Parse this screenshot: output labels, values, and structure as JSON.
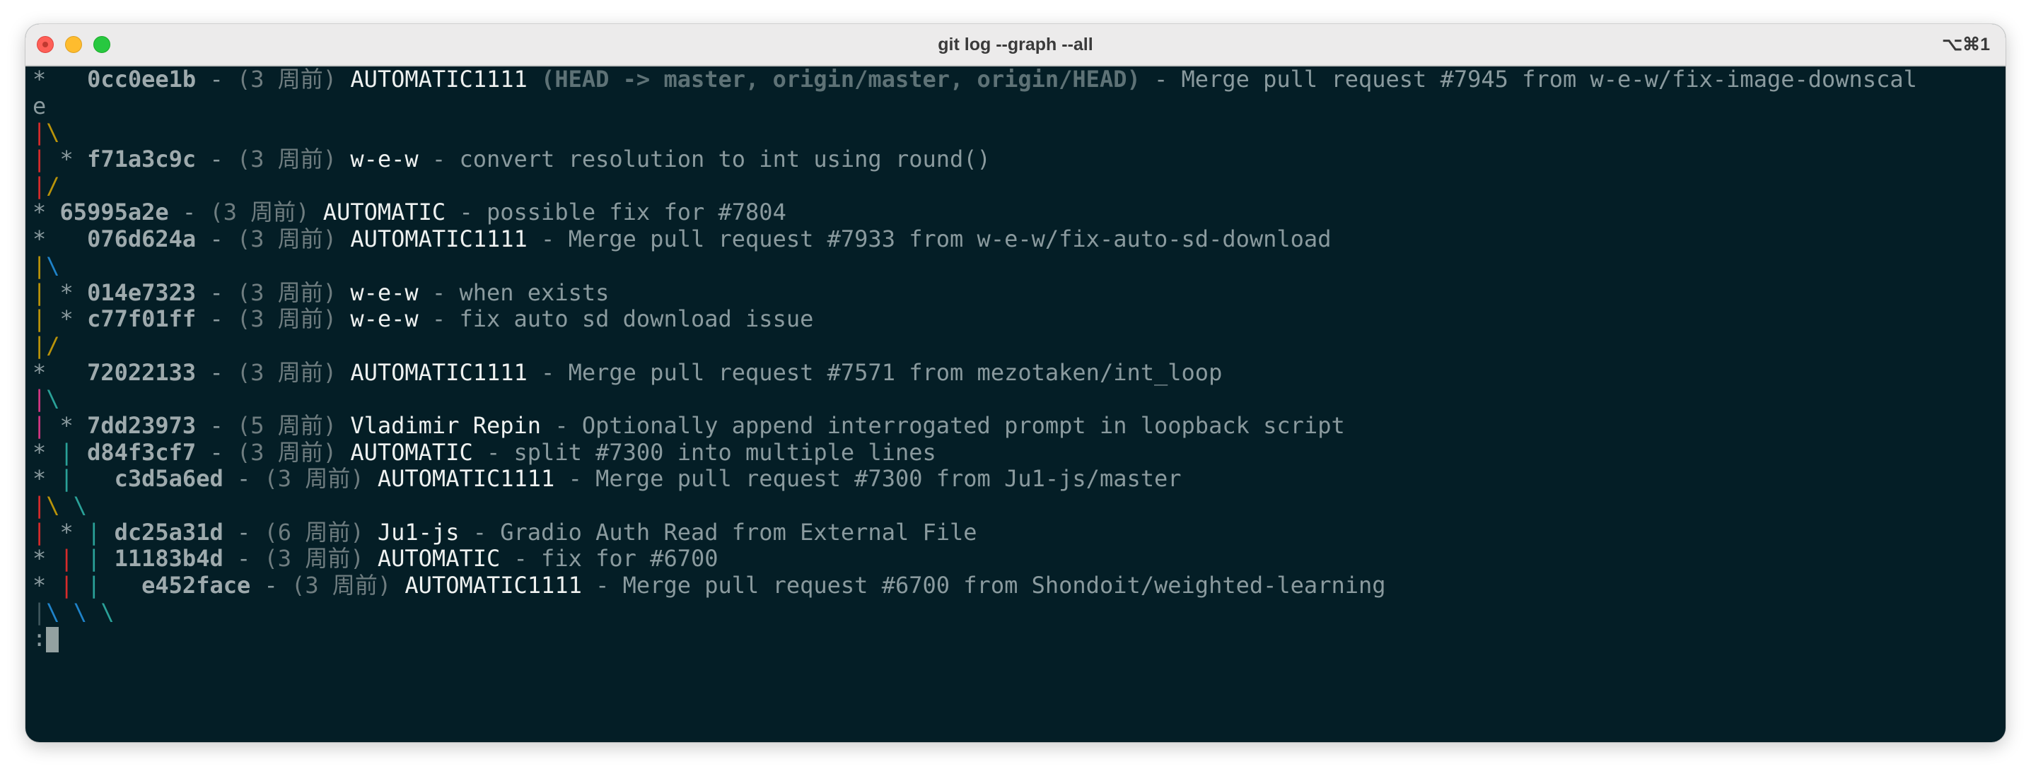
{
  "window": {
    "title": "git log --graph  --all",
    "shortcut": "⌥⌘1"
  },
  "colors": {
    "background": "#041e26",
    "red": "#d62b2b",
    "yellow": "#b9930a",
    "blue": "#1f83c9",
    "magenta": "#d33682",
    "cyan": "#2aa198",
    "grey": "#3f565c"
  },
  "lines": [
    {
      "graph": [
        {
          "t": "*   ",
          "c": "star"
        }
      ],
      "hash": "0cc0ee1b",
      "date": "(3 周前)",
      "author": "AUTOMATIC1111",
      "refs": "(HEAD -> master, origin/master, origin/HEAD)",
      "msg": "Merge pull request #7945 from w-e-w/fix-image-downscal"
    },
    {
      "graph": [
        {
          "t": "e",
          "c": "msg"
        }
      ]
    },
    {
      "graph": [
        {
          "t": "|",
          "c": "red"
        },
        {
          "t": "\\",
          "c": "yellow"
        }
      ]
    },
    {
      "graph": [
        {
          "t": "|",
          "c": "red"
        },
        {
          "t": " * ",
          "c": "star"
        }
      ],
      "hash": "f71a3c9c",
      "date": "(3 周前)",
      "author": "w-e-w",
      "msg": "convert resolution to int using round()"
    },
    {
      "graph": [
        {
          "t": "|",
          "c": "red"
        },
        {
          "t": "/",
          "c": "yellow"
        }
      ]
    },
    {
      "graph": [
        {
          "t": "* ",
          "c": "star"
        }
      ],
      "hash": "65995a2e",
      "date": "(3 周前)",
      "author": "AUTOMATIC",
      "msg": "possible fix for #7804"
    },
    {
      "graph": [
        {
          "t": "*   ",
          "c": "star"
        }
      ],
      "hash": "076d624a",
      "date": "(3 周前)",
      "author": "AUTOMATIC1111",
      "msg": "Merge pull request #7933 from w-e-w/fix-auto-sd-download"
    },
    {
      "graph": [
        {
          "t": "|",
          "c": "yellow"
        },
        {
          "t": "\\",
          "c": "blue"
        }
      ]
    },
    {
      "graph": [
        {
          "t": "|",
          "c": "yellow"
        },
        {
          "t": " * ",
          "c": "star"
        }
      ],
      "hash": "014e7323",
      "date": "(3 周前)",
      "author": "w-e-w",
      "msg": "when exists"
    },
    {
      "graph": [
        {
          "t": "|",
          "c": "yellow"
        },
        {
          "t": " * ",
          "c": "star"
        }
      ],
      "hash": "c77f01ff",
      "date": "(3 周前)",
      "author": "w-e-w",
      "msg": "fix auto sd download issue"
    },
    {
      "graph": [
        {
          "t": "|",
          "c": "yellow"
        },
        {
          "t": "/",
          "c": "yellow"
        }
      ]
    },
    {
      "graph": [
        {
          "t": "*   ",
          "c": "star"
        }
      ],
      "hash": "72022133",
      "date": "(3 周前)",
      "author": "AUTOMATIC1111",
      "msg": "Merge pull request #7571 from mezotaken/int_loop"
    },
    {
      "graph": [
        {
          "t": "|",
          "c": "magenta"
        },
        {
          "t": "\\",
          "c": "cyan"
        }
      ]
    },
    {
      "graph": [
        {
          "t": "|",
          "c": "magenta"
        },
        {
          "t": " * ",
          "c": "star"
        }
      ],
      "hash": "7dd23973",
      "date": "(5 周前)",
      "author": "Vladimir Repin",
      "msg": "Optionally append interrogated prompt in loopback script"
    },
    {
      "graph": [
        {
          "t": "* ",
          "c": "star"
        },
        {
          "t": "|",
          "c": "cyan"
        },
        {
          "t": " ",
          "c": "star"
        }
      ],
      "hash": "d84f3cf7",
      "date": "(3 周前)",
      "author": "AUTOMATIC",
      "msg": "split #7300 into multiple lines"
    },
    {
      "graph": [
        {
          "t": "* ",
          "c": "star"
        },
        {
          "t": "|",
          "c": "cyan"
        },
        {
          "t": "   ",
          "c": "star"
        }
      ],
      "hash": "c3d5a6ed",
      "date": "(3 周前)",
      "author": "AUTOMATIC1111",
      "msg": "Merge pull request #7300 from Ju1-js/master"
    },
    {
      "graph": [
        {
          "t": "|",
          "c": "red"
        },
        {
          "t": "\\",
          "c": "yellow"
        },
        {
          "t": " ",
          "c": "star"
        },
        {
          "t": "\\",
          "c": "cyan"
        }
      ]
    },
    {
      "graph": [
        {
          "t": "|",
          "c": "red"
        },
        {
          "t": " * ",
          "c": "star"
        },
        {
          "t": "|",
          "c": "cyan"
        },
        {
          "t": " ",
          "c": "star"
        }
      ],
      "hash": "dc25a31d",
      "date": "(6 周前)",
      "author": "Ju1-js",
      "msg": "Gradio Auth Read from External File"
    },
    {
      "graph": [
        {
          "t": "* ",
          "c": "star"
        },
        {
          "t": "|",
          "c": "red"
        },
        {
          "t": " ",
          "c": "star"
        },
        {
          "t": "|",
          "c": "cyan"
        },
        {
          "t": " ",
          "c": "star"
        }
      ],
      "hash": "11183b4d",
      "date": "(3 周前)",
      "author": "AUTOMATIC",
      "msg": "fix for #6700"
    },
    {
      "graph": [
        {
          "t": "* ",
          "c": "star"
        },
        {
          "t": "|",
          "c": "red"
        },
        {
          "t": " ",
          "c": "star"
        },
        {
          "t": "|",
          "c": "cyan"
        },
        {
          "t": "   ",
          "c": "star"
        }
      ],
      "hash": "e452face",
      "date": "(3 周前)",
      "author": "AUTOMATIC1111",
      "msg": "Merge pull request #6700 from Shondoit/weighted-learning"
    },
    {
      "graph": [
        {
          "t": "|",
          "c": "grey"
        },
        {
          "t": "\\",
          "c": "blue"
        },
        {
          "t": " ",
          "c": "star"
        },
        {
          "t": "\\",
          "c": "blue"
        },
        {
          "t": " ",
          "c": "star"
        },
        {
          "t": "\\",
          "c": "cyan"
        }
      ]
    }
  ],
  "prompt": ":"
}
